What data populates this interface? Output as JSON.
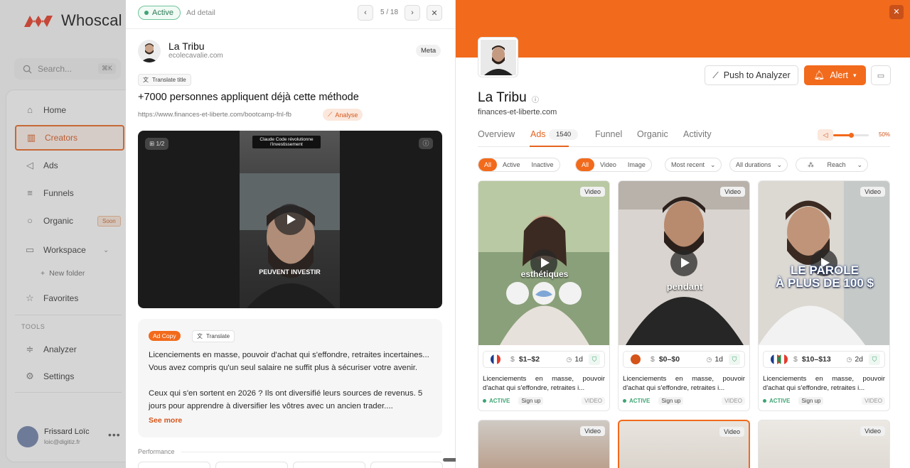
{
  "app": {
    "brand": "Whoscal",
    "search_placeholder": "Search...",
    "search_shortcut": "⌘K",
    "nav": [
      {
        "label": "Home",
        "icon": "home-icon"
      },
      {
        "label": "Creators",
        "icon": "bar-chart-icon"
      },
      {
        "label": "Ads",
        "icon": "megaphone-icon"
      },
      {
        "label": "Funnels",
        "icon": "funnel-icon"
      },
      {
        "label": "Organic",
        "icon": "search-icon",
        "badge": "Soon"
      },
      {
        "label": "Workspace",
        "icon": "folder-icon"
      },
      {
        "label": "New folder",
        "icon": "plus-icon"
      },
      {
        "label": "Favorites",
        "icon": "star-icon"
      }
    ],
    "tools_label": "TOOLS",
    "tools": [
      {
        "label": "Analyzer",
        "icon": "sliders-icon"
      },
      {
        "label": "Settings",
        "icon": "gear-icon"
      }
    ],
    "user": {
      "name": "Frissard Loïc",
      "email": "loic@digitiz.fr"
    }
  },
  "ad_detail": {
    "status": "Active",
    "title": "Ad detail",
    "pager": "5 / 18",
    "advertiser": {
      "name": "La Tribu",
      "domain": "ecolecavalie.com",
      "platform": "Meta"
    },
    "translate_title_label": "Translate title",
    "headline": "+7000 personnes appliquent déjà cette méthode",
    "url": "https://www.finances-et-liberte.com/bootcamp-fnl-fb",
    "analyse_label": "Analyse",
    "media_counter": "1/2",
    "video_caption_top": "Claude Code révolutionne l'investissement",
    "video_caption_bottom": "PEUVENT INVESTIR",
    "ad_copy_label": "Ad Copy",
    "translate_label": "Translate",
    "copy_p1": "Licenciements en masse, pouvoir d'achat qui s'effondre, retraites incertaines... Vous avez compris qu'un seul salaire ne suffit plus à sécuriser votre avenir.",
    "copy_p2": "Ceux qui s'en sortent en 2026 ? Ils ont diversifié leurs sources de revenus. 5 jours pour apprendre à diversifier les vôtres avec un ancien trader....",
    "see_more": "See more",
    "performance_label": "Performance"
  },
  "creator": {
    "name": "La Tribu",
    "domain": "finances-et-liberte.com",
    "push_label": "Push to Analyzer",
    "alert_label": "Alert",
    "tabs": [
      "Overview",
      "Ads",
      "Funnel",
      "Organic",
      "Activity"
    ],
    "ads_count": "1540",
    "volume_pct": "50%",
    "volume_level": 0.5,
    "status_filters": [
      "All",
      "Active",
      "Inactive"
    ],
    "media_filters": [
      "All",
      "Video",
      "Image"
    ],
    "sort_label": "Most recent",
    "duration_label": "All durations",
    "reach_label": "Reach",
    "cards": [
      {
        "tag": "Video",
        "overlay": "esthétiques",
        "price": "$1–$2",
        "age": "1d",
        "text": "Licenciements en masse, pouvoir d'achat qui s'effondre, retraites i...",
        "status": "ACTIVE",
        "cta": "Sign up",
        "type": "VIDEO"
      },
      {
        "tag": "Video",
        "overlay": "pendant",
        "price": "$0–$0",
        "age": "1d",
        "text": "Licenciements en masse, pouvoir d'achat qui s'effondre, retraites i...",
        "status": "ACTIVE",
        "cta": "Sign up",
        "type": "VIDEO"
      },
      {
        "tag": "Video",
        "overlay_l1": "LE PAROLE",
        "overlay_l2": "À PLUS DE 100 $",
        "price": "$10–$13",
        "age": "2d",
        "text": "Licenciements en masse, pouvoir d'achat qui s'effondre, retraites i...",
        "status": "ACTIVE",
        "cta": "Sign up",
        "type": "VIDEO"
      }
    ],
    "row2_tags": [
      "Video",
      "Video",
      "Video"
    ],
    "colors": {
      "accent": "#f26a1b",
      "active_green": "#3ea474"
    }
  }
}
